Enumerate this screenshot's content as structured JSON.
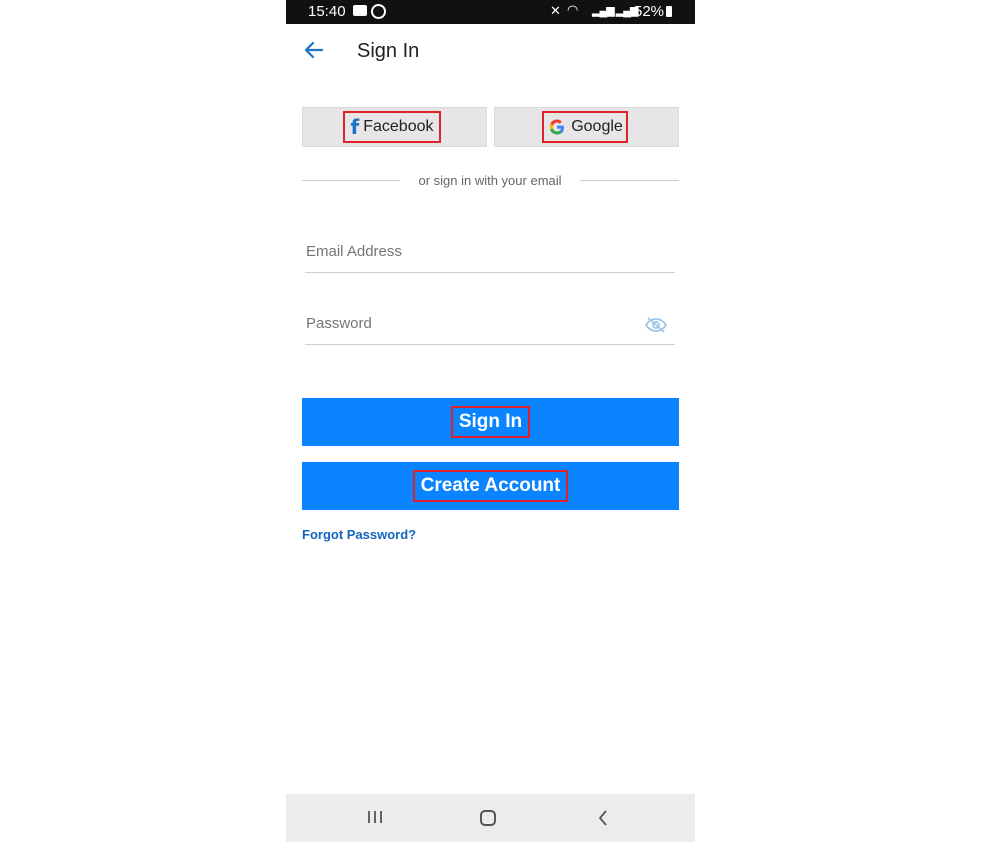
{
  "status_bar": {
    "time": "15:40",
    "battery": "52%",
    "icons": [
      "message-icon",
      "whatsapp-icon",
      "mute-icon",
      "wifi-icon",
      "signal-icon",
      "battery-icon"
    ]
  },
  "header": {
    "title": "Sign In",
    "back_icon": "back-arrow-icon"
  },
  "social": {
    "facebook_label": "Facebook",
    "google_label": "Google"
  },
  "divider_text": "or sign in with your email",
  "form": {
    "email_placeholder": "Email Address",
    "email_value": "",
    "password_placeholder": "Password",
    "password_value": ""
  },
  "buttons": {
    "sign_in": "Sign In",
    "create_account": "Create Account"
  },
  "forgot_password": "Forgot Password?",
  "colors": {
    "primary": "#0a84ff",
    "highlight": "#e0202a",
    "link": "#1565c0"
  }
}
